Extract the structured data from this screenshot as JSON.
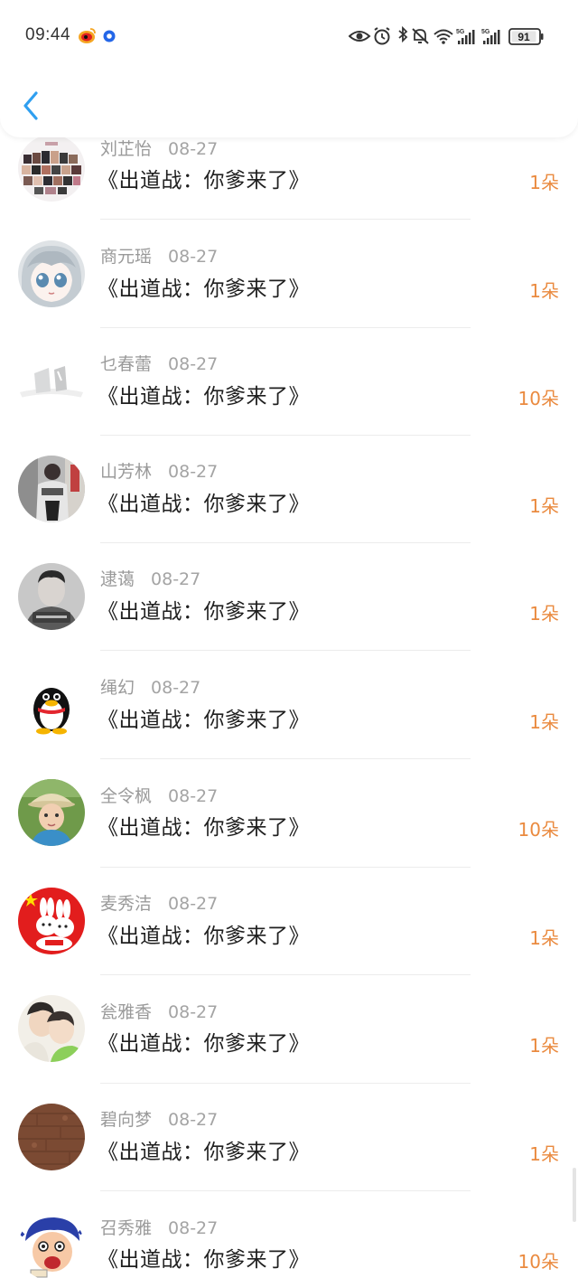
{
  "status_bar": {
    "time": "09:44",
    "battery": "91",
    "signal_1": "5G",
    "signal_2": "5G"
  },
  "nav": {
    "back_icon": "chevron-left-icon",
    "accent_color": "#2f9ff0"
  },
  "colors": {
    "amount": "#ea8a3f",
    "name": "#9a9a9a",
    "title": "#1f1f1f"
  },
  "records": [
    {
      "name": "刘芷怡",
      "date": "08-27",
      "title": "《出道战：你爹来了》",
      "amount": "1朵"
    },
    {
      "name": "商元瑶",
      "date": "08-27",
      "title": "《出道战：你爹来了》",
      "amount": "1朵"
    },
    {
      "name": "乜春蕾",
      "date": "08-27",
      "title": "《出道战：你爹来了》",
      "amount": "10朵"
    },
    {
      "name": "山芳林",
      "date": "08-27",
      "title": "《出道战：你爹来了》",
      "amount": "1朵"
    },
    {
      "name": "逮蔼",
      "date": "08-27",
      "title": "《出道战：你爹来了》",
      "amount": "1朵"
    },
    {
      "name": "绳幻",
      "date": "08-27",
      "title": "《出道战：你爹来了》",
      "amount": "1朵"
    },
    {
      "name": "全令枫",
      "date": "08-27",
      "title": "《出道战：你爹来了》",
      "amount": "10朵"
    },
    {
      "name": "麦秀洁",
      "date": "08-27",
      "title": "《出道战：你爹来了》",
      "amount": "1朵"
    },
    {
      "name": "瓮雅香",
      "date": "08-27",
      "title": "《出道战：你爹来了》",
      "amount": "1朵"
    },
    {
      "name": "碧向梦",
      "date": "08-27",
      "title": "《出道战：你爹来了》",
      "amount": "1朵"
    },
    {
      "name": "召秀雅",
      "date": "08-27",
      "title": "《出道战：你爹来了》",
      "amount": "10朵"
    }
  ]
}
